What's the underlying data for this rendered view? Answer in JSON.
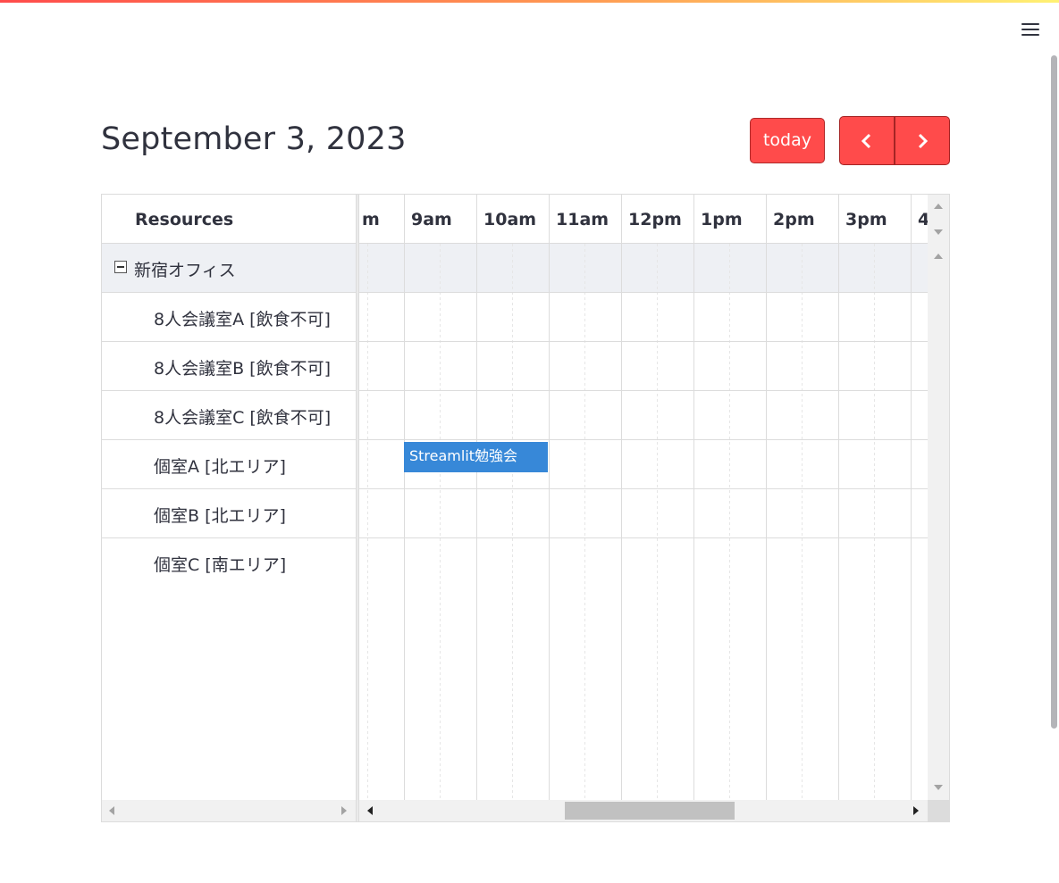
{
  "app": {
    "accent_color": "#ff4b4b",
    "event_color": "#3788d8"
  },
  "header": {
    "menu_icon": "hamburger-menu-icon"
  },
  "toolbar": {
    "title": "September 3, 2023",
    "today_label": "today",
    "prev_icon": "chevron-left-icon",
    "next_icon": "chevron-right-icon"
  },
  "calendar": {
    "resource_header": "Resources",
    "hours": [
      "m",
      "9am",
      "10am",
      "11am",
      "12pm",
      "1pm",
      "2pm",
      "3pm",
      "4"
    ],
    "resources": [
      {
        "label": "新宿オフィス",
        "type": "group",
        "expanded": true
      },
      {
        "label": "8人会議室A [飲食不可]",
        "type": "child"
      },
      {
        "label": "8人会議室B [飲食不可]",
        "type": "child"
      },
      {
        "label": "8人会議室C [飲食不可]",
        "type": "child"
      },
      {
        "label": "個室A [北エリア]",
        "type": "child"
      },
      {
        "label": "個室B [北エリア]",
        "type": "child"
      },
      {
        "label": "個室C [南エリア]",
        "type": "child"
      }
    ],
    "events": [
      {
        "title": "Streamlit勉強会",
        "resource": "個室A [北エリア]",
        "start": "9am",
        "end": "11am"
      }
    ]
  }
}
